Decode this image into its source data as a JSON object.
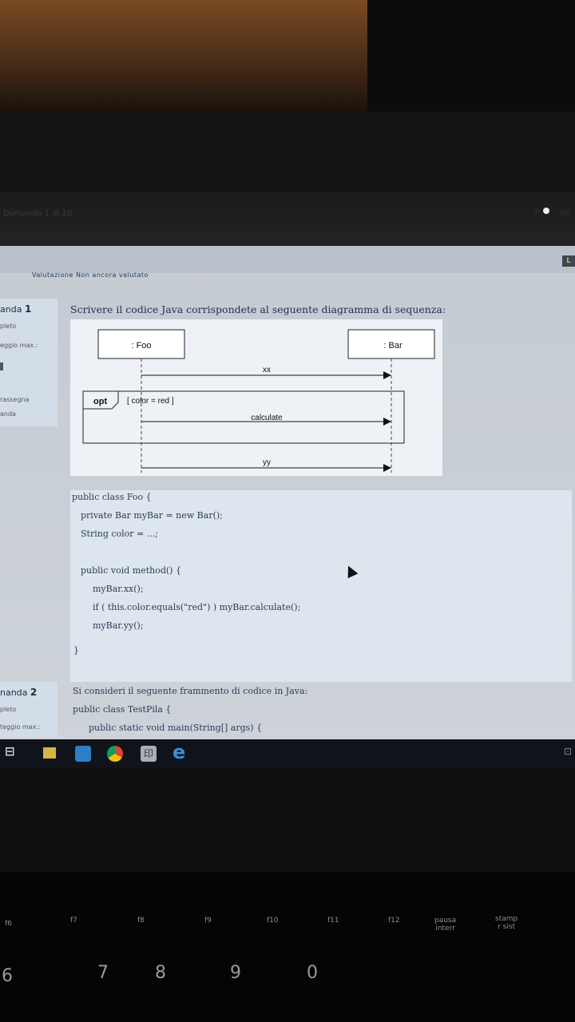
{
  "browser": {
    "tab_title": "Domanda 1 di 10",
    "corner_text": "po"
  },
  "quiz": {
    "top_status": "Valutazione   Non ancora valutato",
    "question1": {
      "label": "anda",
      "number": "1",
      "status": "pleto",
      "score": "eggio max.:",
      "flag": "rassegna",
      "flag2": "anda",
      "title": "Scrivere il codice Java corrispondete al seguente diagramma di sequenza:"
    },
    "diagram": {
      "foo": ": Foo",
      "bar": ": Bar",
      "msg_xx": "xx",
      "opt": "opt",
      "guard": "[ color = red ]",
      "msg_calculate": "calculate",
      "msg_yy": "yy"
    },
    "code": [
      "public class Foo {",
      "private Bar myBar = new Bar();",
      "String color = ...;",
      "public void method() {",
      "myBar.xx();",
      "if ( this.color.equals(\"red\") ) myBar.calculate();",
      "myBar.yy();",
      "}"
    ],
    "question2": {
      "label": "nanda",
      "number": "2",
      "status": "pleto",
      "score": "teggio max.:",
      "line1": "Si consideri il seguente frammento di codice in Java:",
      "line2": "public class TestPila {",
      "line3": "public static void main(String[] args) {"
    }
  },
  "taskbar": {
    "pdf_label": "印"
  },
  "keyboard": {
    "fkeys": [
      "f6",
      "f7",
      "f8",
      "f9",
      "f10",
      "f11",
      "f12"
    ],
    "pausa": "pausa\ninterr",
    "stamp": "stamp\nr sist",
    "digits": [
      "6",
      "7",
      "8",
      "9",
      "0"
    ]
  }
}
